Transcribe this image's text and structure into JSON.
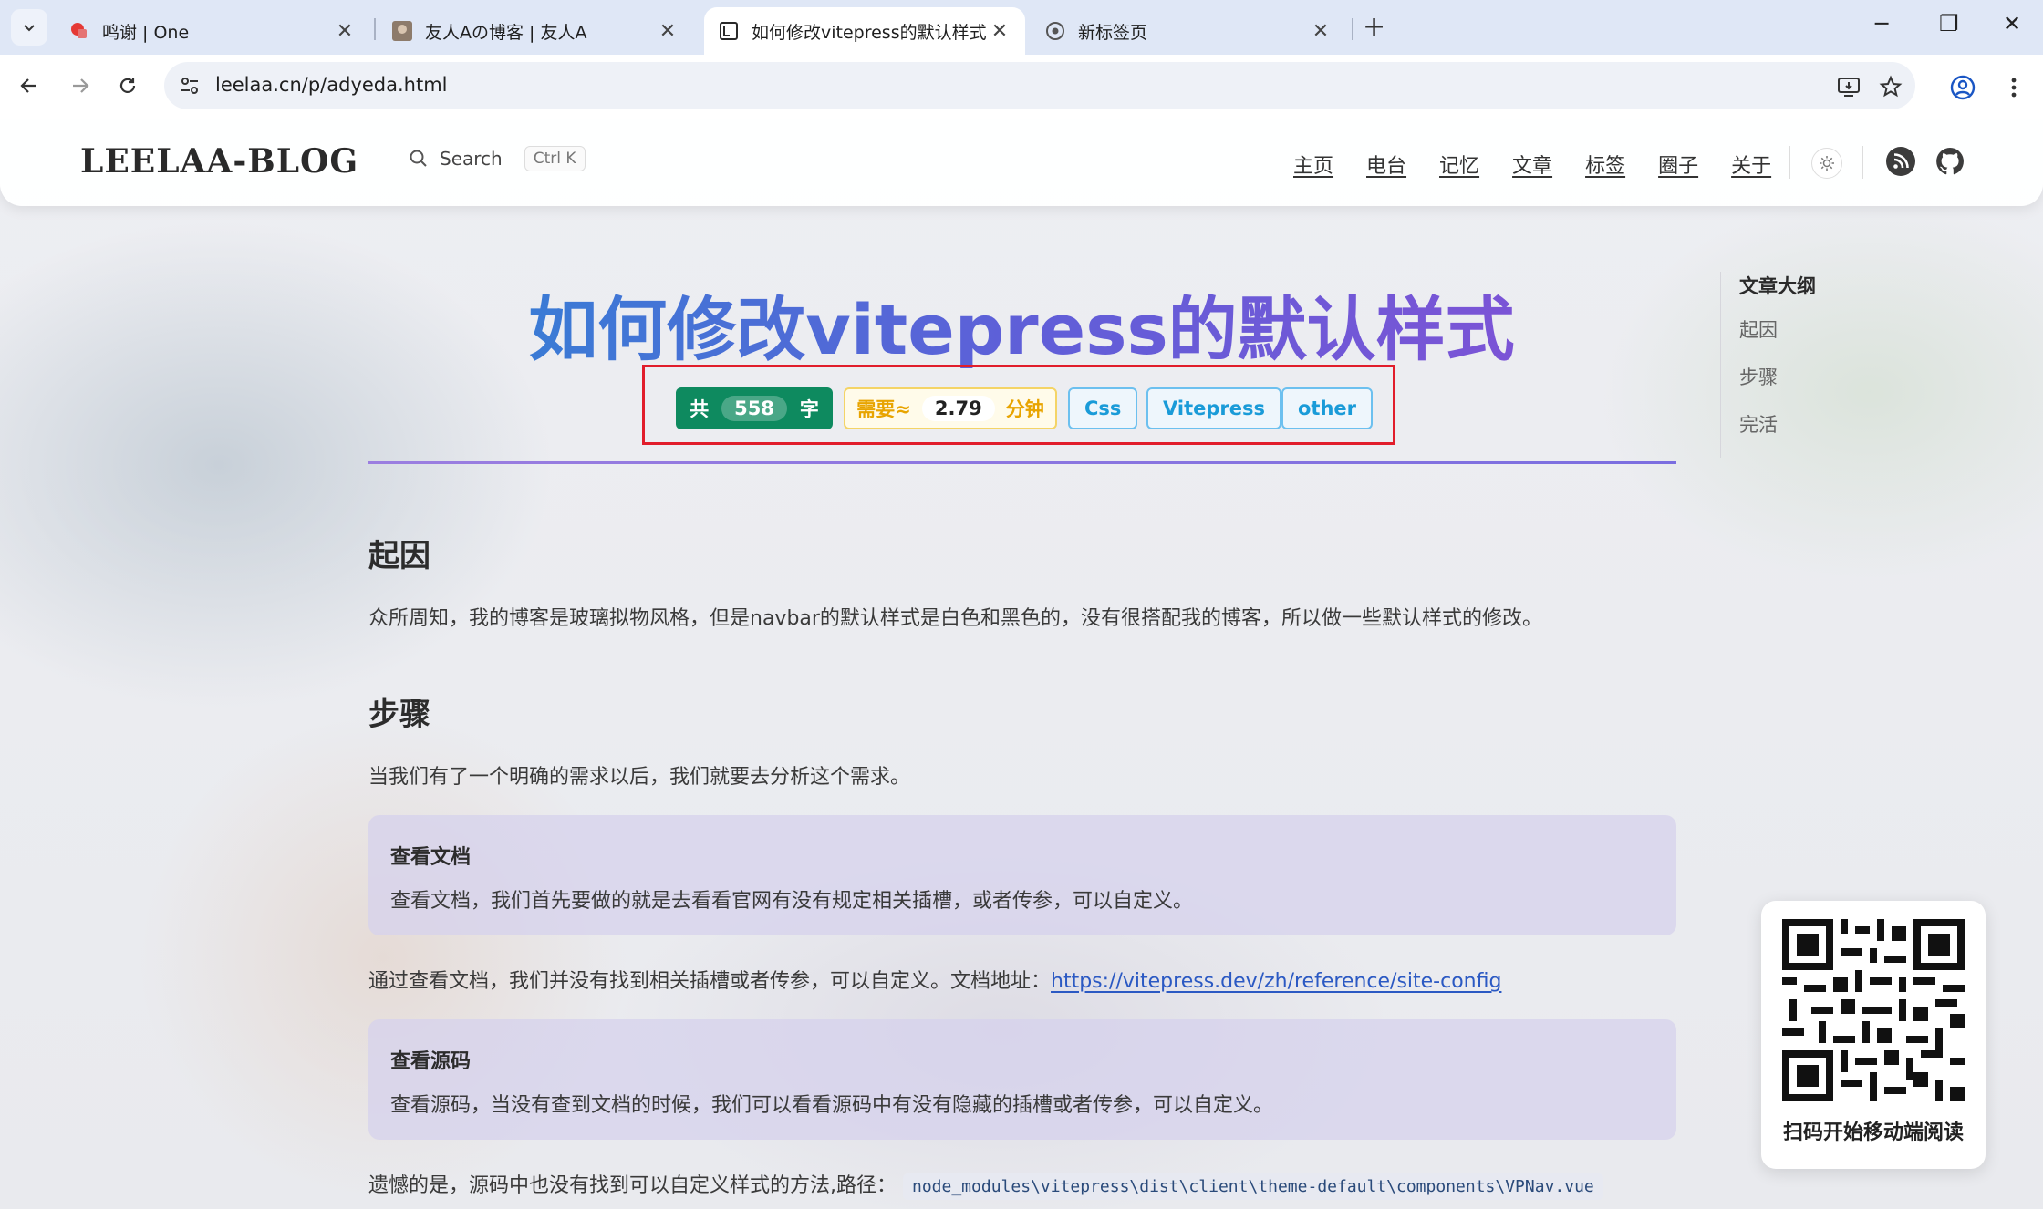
{
  "browser": {
    "tabs": [
      {
        "title": "鸣谢 | One",
        "active": false
      },
      {
        "title": "友人Aの博客 | 友人A",
        "active": false
      },
      {
        "title": "如何修改vitepress的默认样式 |",
        "active": true
      },
      {
        "title": "新标签页",
        "active": false
      }
    ],
    "url": "leelaa.cn/p/adyeda.html"
  },
  "site": {
    "logo": "LEELAA-BLOG",
    "search_label": "Search",
    "search_shortcut": "Ctrl K",
    "nav": [
      "主页",
      "电台",
      "记忆",
      "文章",
      "标签",
      "圈子",
      "关于"
    ]
  },
  "article": {
    "title": "如何修改vitepress的默认样式",
    "meta": {
      "words_prefix": "共",
      "word_count": "558",
      "words_suffix": "字",
      "time_prefix": "需要≈",
      "read_minutes": "2.79",
      "time_suffix": "分钟",
      "tags": [
        "Css",
        "Vitepress",
        "other"
      ]
    },
    "sections": {
      "cause_heading": "起因",
      "cause_text": "众所周知，我的博客是玻璃拟物风格，但是navbar的默认样式是白色和黑色的，没有很搭配我的博客，所以做一些默认样式的修改。",
      "steps_heading": "步骤",
      "steps_text": "当我们有了一个明确的需求以后，我们就要去分析这个需求。",
      "callout1_title": "查看文档",
      "callout1_text": "查看文档，我们首先要做的就是去看看官网有没有规定相关插槽，或者传参，可以自定义。",
      "docs_text": "通过查看文档，我们并没有找到相关插槽或者传参，可以自定义。文档地址：",
      "docs_link": "https://vitepress.dev/zh/reference/site-config",
      "callout2_title": "查看源码",
      "callout2_text": "查看源码，当没有查到文档的时候，我们可以看看源码中有没有隐藏的插槽或者传参，可以自定义。",
      "regret_text": "遗憾的是，源码中也没有找到可以自定义样式的方法,路径：",
      "code_path": "node_modules\\vitepress\\dist\\client\\theme-default\\components\\VPNav.vue"
    }
  },
  "toc": {
    "title": "文章大纲",
    "items": [
      "起因",
      "步骤",
      "完活"
    ]
  },
  "qr": {
    "caption": "扫码开始移动端阅读"
  },
  "colors": {
    "title_gradient_start": "#3a7bd5",
    "title_gradient_end": "#7b54d6",
    "word_badge": "#0e8a5f",
    "time_badge": "#e8a400",
    "tag": "#1a9bd8",
    "highlight_box": "#e11d2b"
  }
}
